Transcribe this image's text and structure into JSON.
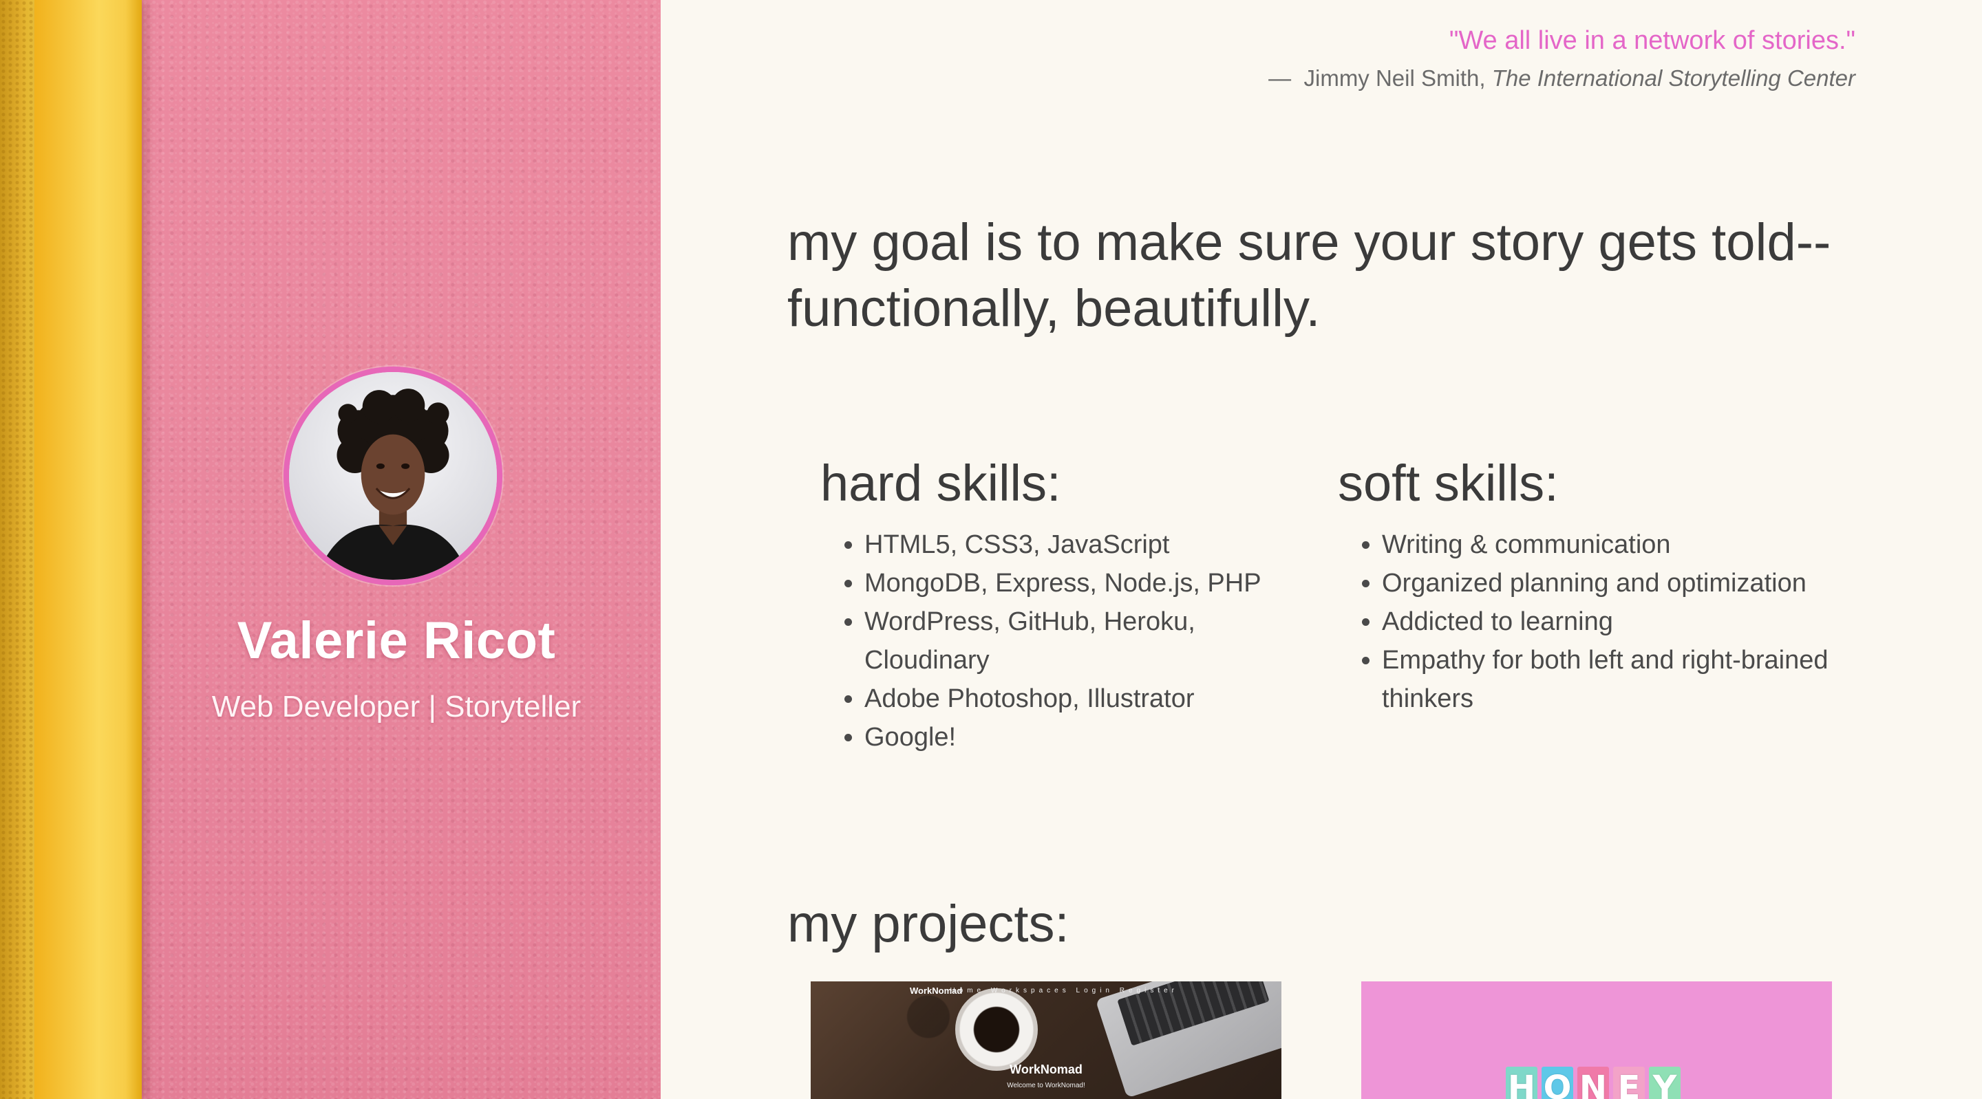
{
  "profile": {
    "name": "Valerie Ricot",
    "subtitle": "Web Developer | Storyteller"
  },
  "quote": {
    "text": "\"We all live in a network of stories.\"",
    "dash": "—",
    "author": "Jimmy Neil Smith,",
    "work": "The International Storytelling Center"
  },
  "goal": "my goal is to make sure your story gets told--functionally, beautifully.",
  "hard_skills": {
    "title": "hard skills:",
    "items": [
      "HTML5, CSS3, JavaScript",
      "MongoDB, Express, Node.js, PHP",
      "WordPress, GitHub, Heroku, Cloudinary",
      "Adobe Photoshop, Illustrator",
      "Google!"
    ]
  },
  "soft_skills": {
    "title": "soft skills:",
    "items": [
      "Writing & communication",
      "Organized planning and optimization",
      "Addicted to learning",
      "Empathy for both left and right-brained thinkers"
    ]
  },
  "projects": {
    "title": "my projects:",
    "items": [
      {
        "brand": "WorkNomad",
        "nav": "Home Workspaces Login Register",
        "hero_title": "WorkNomad",
        "hero_sub": "Welcome to WorkNomad!"
      },
      {
        "letters": [
          "H",
          "O",
          "N",
          "E",
          "Y"
        ],
        "letter_colors": [
          "#7fd8c9",
          "#5ec8e8",
          "#f07aa8",
          "#f3a3c8",
          "#8fe0b5"
        ]
      }
    ]
  },
  "colors": {
    "accent_pink": "#e466c8",
    "avatar_border": "#e767b8",
    "background": "#fbf8f1",
    "wall_pink": "#ec8aa0",
    "pole_yellow": "#f6c43a"
  }
}
